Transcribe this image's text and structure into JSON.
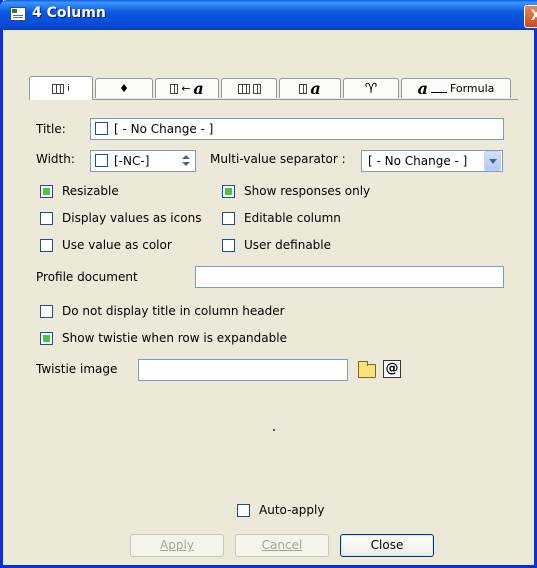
{
  "window": {
    "title": "4 Column",
    "close_glyph": "X"
  },
  "tabs": [
    {
      "icon": "column-info-icon",
      "active": true
    },
    {
      "icon": "sort-icon",
      "glyph": "♦"
    },
    {
      "icon": "font-icon",
      "glyph": "a"
    },
    {
      "icon": "numbers-icon"
    },
    {
      "icon": "title-font-icon",
      "glyph": "a"
    },
    {
      "icon": "advanced-format-icon",
      "glyph": "♈"
    },
    {
      "icon": "formula-icon",
      "glyph": "a",
      "label": "Formula"
    }
  ],
  "form": {
    "title_label": "Title:",
    "title_value": "[ - No Change - ]",
    "width_label": "Width:",
    "width_value": "[-NC-]",
    "multivalue_label": "Multi-value separator :",
    "multivalue_value": "[ - No Change - ]",
    "checkboxes": {
      "resizable": {
        "label": "Resizable",
        "checked": true
      },
      "show_responses_only": {
        "label": "Show responses only",
        "checked": true
      },
      "display_values_as_icons": {
        "label": "Display values as icons",
        "checked": false
      },
      "editable_column": {
        "label": "Editable column",
        "checked": false
      },
      "use_value_as_color": {
        "label": "Use value as color",
        "checked": false
      },
      "user_definable": {
        "label": "User definable",
        "checked": false
      },
      "do_not_display_title": {
        "label": "Do not display title in column header",
        "checked": false
      },
      "show_twistie": {
        "label": "Show twistie when row is expandable",
        "checked": true
      },
      "auto_apply": {
        "label": "Auto-apply",
        "checked": false
      }
    },
    "profile_document_label": "Profile document",
    "profile_document_value": "",
    "twistie_image_label": "Twistie image",
    "twistie_image_value": ""
  },
  "buttons": {
    "apply": {
      "label": "Apply",
      "enabled": false
    },
    "cancel": {
      "label": "Cancel",
      "enabled": false
    },
    "close": {
      "label": "Close",
      "enabled": true
    }
  },
  "colors": {
    "title_bar": "#0a5ae0",
    "dialog_bg": "#ece9d8",
    "check_fill": "#4fc04a"
  }
}
